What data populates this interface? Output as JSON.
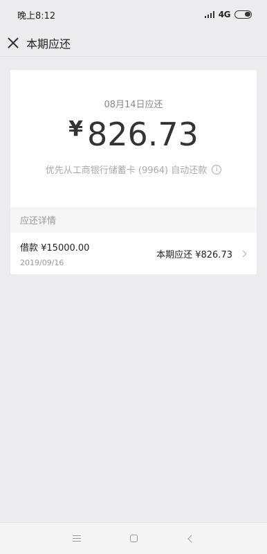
{
  "status_bar": {
    "time": "晚上8:12",
    "network": "4G",
    "icons": [
      "signal-icon",
      "battery-icon"
    ]
  },
  "header": {
    "title": "本期应还",
    "close_icon": "close-icon"
  },
  "summary": {
    "due_date": "08月14日应还",
    "currency": "¥",
    "amount": "826.73",
    "autopay_text": "优先从工商银行储蓄卡 (9964) 自动还款",
    "info_icon": "info-icon"
  },
  "details": {
    "section_title": "应还详情",
    "loan_label": "借款 ¥15000.00",
    "loan_date": "2019/09/16",
    "period_due": "本期应还 ¥826.73"
  },
  "nav_bar": {
    "icons": [
      "menu-icon",
      "home-icon",
      "back-icon"
    ]
  },
  "colors": {
    "background": "#ececee",
    "card": "#ffffff",
    "text_primary": "#222222",
    "text_muted": "#999999"
  }
}
